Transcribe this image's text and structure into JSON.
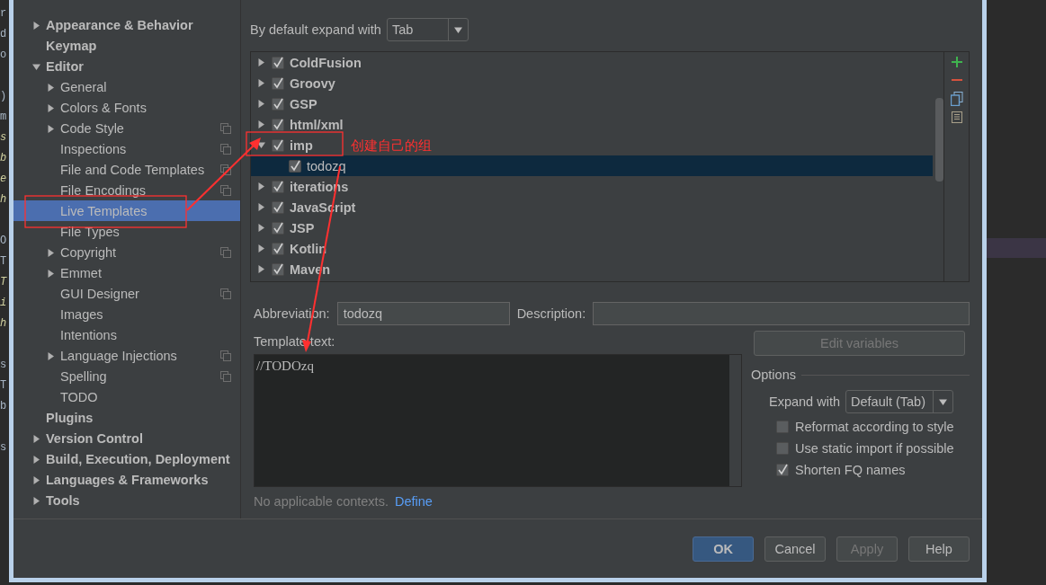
{
  "editor_left": {
    "lines": [
      {
        "text": "r"
      },
      {
        "text": "d"
      },
      {
        "text": "o"
      },
      {
        "kind": "blank"
      },
      {
        "text": ")"
      },
      {
        "text": "m"
      },
      {
        "text": "s",
        "kind": "italic"
      },
      {
        "text": "b",
        "kind": "italic"
      },
      {
        "text": "e",
        "kind": "italic"
      },
      {
        "text": "h",
        "kind": "italic"
      },
      {
        "kind": "blank"
      },
      {
        "text": "O"
      },
      {
        "text": "T"
      },
      {
        "text": "T",
        "kind": "italic"
      },
      {
        "text": "i",
        "kind": "italic"
      },
      {
        "text": "h",
        "kind": "italic"
      },
      {
        "kind": "blank"
      },
      {
        "text": "s"
      },
      {
        "text": "T"
      },
      {
        "text": "b"
      },
      {
        "kind": "blank"
      },
      {
        "text": "s"
      }
    ]
  },
  "sidebar": {
    "items": [
      {
        "label": "Appearance & Behavior",
        "expanded": false,
        "selected": false
      },
      {
        "label": "Keymap",
        "selected": false
      },
      {
        "label": "Editor",
        "expanded": true,
        "selected": false,
        "children": [
          {
            "label": "General",
            "expanded": false,
            "selected": false
          },
          {
            "label": "Colors & Fonts",
            "expanded": false,
            "selected": false
          },
          {
            "label": "Code Style",
            "expanded": false,
            "selected": false,
            "shared": true
          },
          {
            "label": "Inspections",
            "selected": false,
            "shared": true
          },
          {
            "label": "File and Code Templates",
            "selected": false,
            "shared": true
          },
          {
            "label": "File Encodings",
            "selected": false,
            "shared": true
          },
          {
            "label": "Live Templates",
            "selected": true
          },
          {
            "label": "File Types",
            "selected": false
          },
          {
            "label": "Copyright",
            "expanded": false,
            "selected": false,
            "shared": true
          },
          {
            "label": "Emmet",
            "expanded": false,
            "selected": false
          },
          {
            "label": "GUI Designer",
            "selected": false,
            "shared": true
          },
          {
            "label": "Images",
            "selected": false
          },
          {
            "label": "Intentions",
            "selected": false
          },
          {
            "label": "Language Injections",
            "expanded": false,
            "selected": false,
            "shared": true
          },
          {
            "label": "Spelling",
            "selected": false,
            "shared": true
          },
          {
            "label": "TODO",
            "selected": false
          }
        ]
      },
      {
        "label": "Plugins",
        "selected": false
      },
      {
        "label": "Version Control",
        "expanded": false,
        "selected": false
      },
      {
        "label": "Build, Execution, Deployment",
        "expanded": false,
        "selected": false
      },
      {
        "label": "Languages & Frameworks",
        "expanded": false,
        "selected": false
      },
      {
        "label": "Tools",
        "expanded": false,
        "selected": false
      }
    ]
  },
  "expand_default": {
    "label": "By default expand with",
    "value": "Tab"
  },
  "templates": {
    "groups": [
      {
        "label": "ColdFusion",
        "checked": true,
        "expanded": false,
        "selected": false
      },
      {
        "label": "Groovy",
        "checked": true,
        "expanded": false,
        "selected": false
      },
      {
        "label": "GSP",
        "checked": true,
        "expanded": false,
        "selected": false
      },
      {
        "label": "html/xml",
        "checked": true,
        "expanded": false,
        "selected": false
      },
      {
        "label": "imp",
        "checked": true,
        "expanded": true,
        "selected": false,
        "children": [
          {
            "label": "todozq",
            "checked": true,
            "selected": true
          }
        ]
      },
      {
        "label": "iterations",
        "checked": true,
        "expanded": false,
        "selected": false
      },
      {
        "label": "JavaScript",
        "checked": true,
        "expanded": false,
        "selected": false
      },
      {
        "label": "JSP",
        "checked": true,
        "expanded": false,
        "selected": false
      },
      {
        "label": "Kotlin",
        "checked": true,
        "expanded": false,
        "selected": false
      },
      {
        "label": "Maven",
        "checked": true,
        "expanded": false,
        "selected": false
      }
    ]
  },
  "abbreviation": {
    "label": "Abbreviation:",
    "value": "todozq"
  },
  "description": {
    "label": "Description:"
  },
  "template_text": {
    "label": "Template text:",
    "value": "//TODOzq"
  },
  "edit_variables": {
    "label": "Edit variables",
    "disabled": true
  },
  "options": {
    "title": "Options",
    "expand_with": {
      "label": "Expand with",
      "value": "Default (Tab)"
    },
    "checkboxes": [
      {
        "label": "Reformat according to style",
        "checked": false
      },
      {
        "label": "Use static import if possible",
        "checked": false
      },
      {
        "label": "Shorten FQ names",
        "checked": true
      }
    ]
  },
  "contexts": {
    "text": "No applicable contexts.",
    "link": "Define"
  },
  "buttons": [
    {
      "label": "OK",
      "kind": "default",
      "disabled": false
    },
    {
      "label": "Cancel",
      "kind": "normal",
      "disabled": false
    },
    {
      "label": "Apply",
      "kind": "normal",
      "disabled": true
    },
    {
      "label": "Help",
      "kind": "normal",
      "disabled": false
    }
  ],
  "annotation": {
    "note": "创建自己的组"
  }
}
